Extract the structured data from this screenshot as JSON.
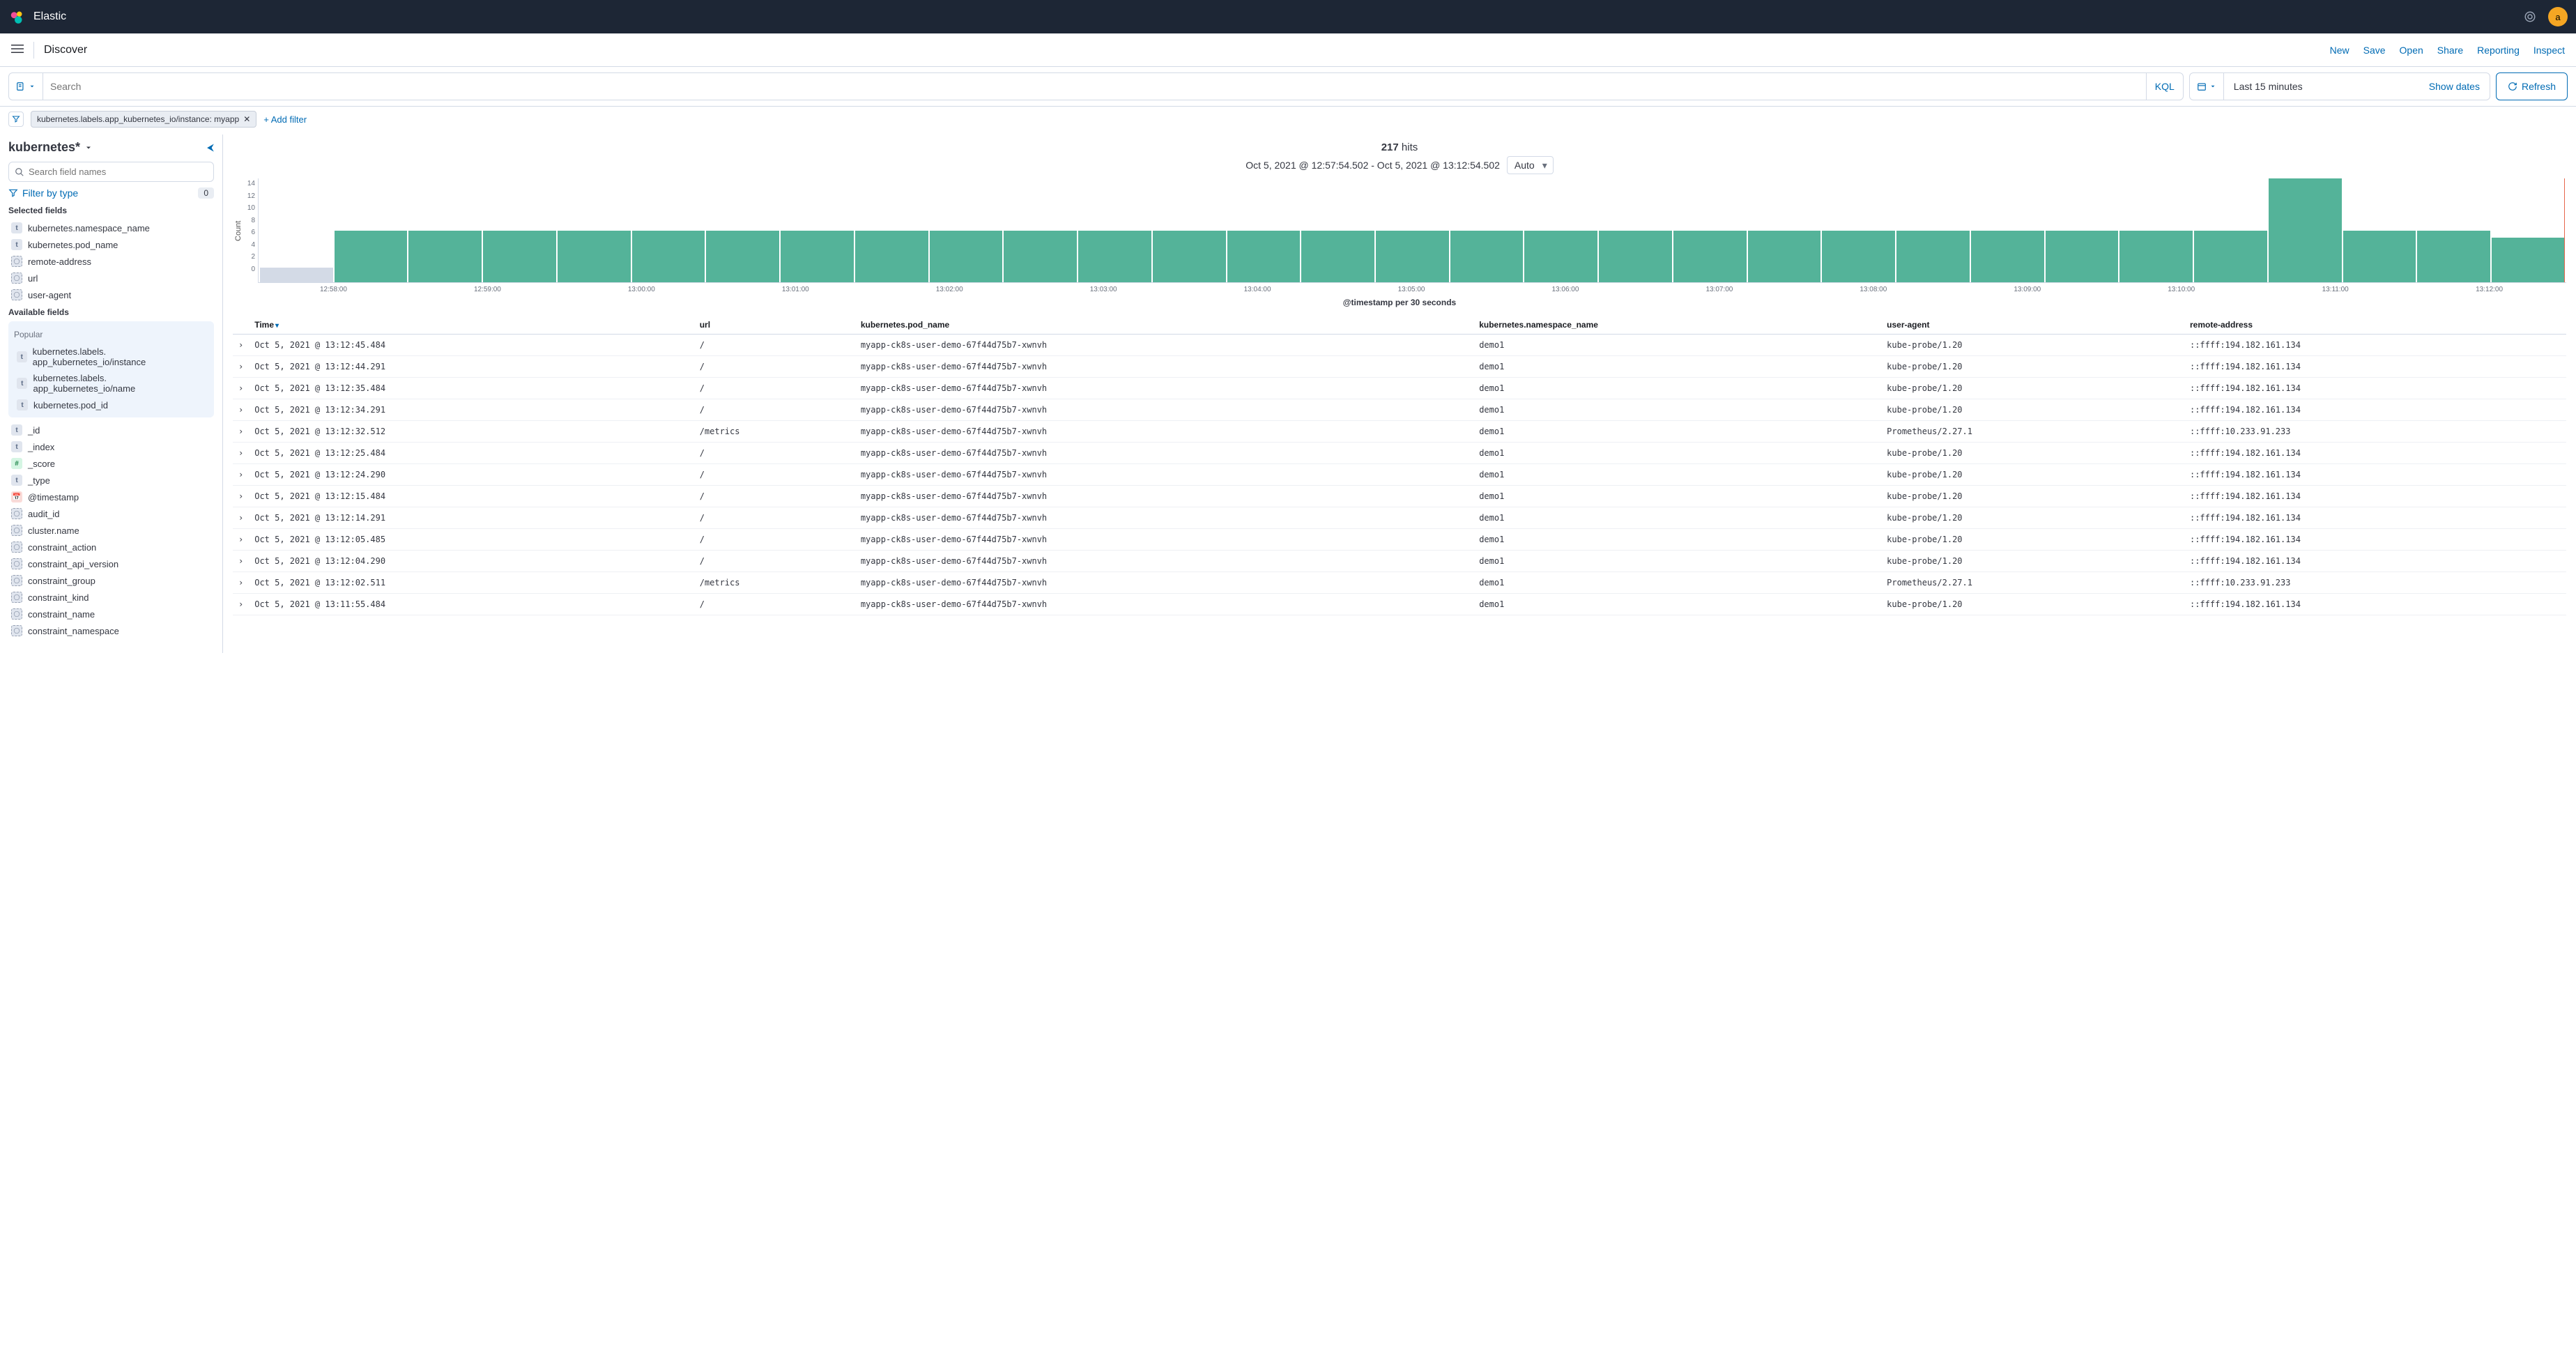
{
  "header": {
    "brand": "Elastic",
    "avatar_letter": "a"
  },
  "subbar": {
    "app_title": "Discover",
    "links": [
      "New",
      "Save",
      "Open",
      "Share",
      "Reporting",
      "Inspect"
    ]
  },
  "search": {
    "placeholder": "Search",
    "lang": "KQL",
    "quick_range": "Last 15 minutes",
    "show_dates": "Show dates",
    "refresh": "Refresh"
  },
  "filterrow": {
    "pill": "kubernetes.labels.app_kubernetes_io/instance: myapp",
    "add_filter": "+ Add filter"
  },
  "sidebar": {
    "index_pattern": "kubernetes*",
    "field_search_placeholder": "Search field names",
    "filter_by_type": "Filter by type",
    "filter_type_count": "0",
    "selected_fields_label": "Selected fields",
    "selected_fields": [
      {
        "type": "t",
        "name": "kubernetes.namespace_name"
      },
      {
        "type": "t",
        "name": "kubernetes.pod_name"
      },
      {
        "type": "n",
        "name": "remote-address"
      },
      {
        "type": "n",
        "name": "url"
      },
      {
        "type": "n",
        "name": "user-agent"
      }
    ],
    "available_fields_label": "Available fields",
    "popular_label": "Popular",
    "popular_fields": [
      {
        "type": "t",
        "name": "kubernetes.labels. app_kubernetes_io/instance"
      },
      {
        "type": "t",
        "name": "kubernetes.labels. app_kubernetes_io/name"
      },
      {
        "type": "t",
        "name": "kubernetes.pod_id"
      }
    ],
    "other_fields": [
      {
        "type": "t",
        "name": "_id"
      },
      {
        "type": "t",
        "name": "_index"
      },
      {
        "type": "nm",
        "name": "_score"
      },
      {
        "type": "t",
        "name": "_type"
      },
      {
        "type": "dt",
        "name": "@timestamp"
      },
      {
        "type": "n",
        "name": "audit_id"
      },
      {
        "type": "n",
        "name": "cluster.name"
      },
      {
        "type": "n",
        "name": "constraint_action"
      },
      {
        "type": "n",
        "name": "constraint_api_version"
      },
      {
        "type": "n",
        "name": "constraint_group"
      },
      {
        "type": "n",
        "name": "constraint_kind"
      },
      {
        "type": "n",
        "name": "constraint_name"
      },
      {
        "type": "n",
        "name": "constraint_namespace"
      }
    ]
  },
  "hits": {
    "count": "217",
    "suffix": "hits"
  },
  "chart_data": {
    "type": "bar",
    "range_text": "Oct 5, 2021 @ 12:57:54.502 - Oct 5, 2021 @ 13:12:54.502",
    "interval_select": "Auto",
    "ylabel": "Count",
    "xlabel": "@timestamp per 30 seconds",
    "ylim": [
      0,
      14
    ],
    "y_ticks": [
      "14",
      "12",
      "10",
      "8",
      "6",
      "4",
      "2",
      "0"
    ],
    "x_ticks": [
      "12:58:00",
      "12:59:00",
      "13:00:00",
      "13:01:00",
      "13:02:00",
      "13:03:00",
      "13:04:00",
      "13:05:00",
      "13:06:00",
      "13:07:00",
      "13:08:00",
      "13:09:00",
      "13:10:00",
      "13:11:00",
      "13:12:00"
    ],
    "values": [
      2,
      7,
      7,
      7,
      7,
      7,
      7,
      7,
      7,
      7,
      7,
      7,
      7,
      7,
      7,
      7,
      7,
      7,
      7,
      7,
      7,
      7,
      7,
      7,
      7,
      7,
      7,
      14,
      7,
      7,
      6
    ],
    "dim_first": true
  },
  "table": {
    "columns": [
      "Time",
      "url",
      "kubernetes.pod_name",
      "kubernetes.namespace_name",
      "user-agent",
      "remote-address"
    ],
    "sort_col": 0,
    "rows": [
      [
        "Oct 5, 2021 @ 13:12:45.484",
        "/",
        "myapp-ck8s-user-demo-67f44d75b7-xwnvh",
        "demo1",
        "kube-probe/1.20",
        "::ffff:194.182.161.134"
      ],
      [
        "Oct 5, 2021 @ 13:12:44.291",
        "/",
        "myapp-ck8s-user-demo-67f44d75b7-xwnvh",
        "demo1",
        "kube-probe/1.20",
        "::ffff:194.182.161.134"
      ],
      [
        "Oct 5, 2021 @ 13:12:35.484",
        "/",
        "myapp-ck8s-user-demo-67f44d75b7-xwnvh",
        "demo1",
        "kube-probe/1.20",
        "::ffff:194.182.161.134"
      ],
      [
        "Oct 5, 2021 @ 13:12:34.291",
        "/",
        "myapp-ck8s-user-demo-67f44d75b7-xwnvh",
        "demo1",
        "kube-probe/1.20",
        "::ffff:194.182.161.134"
      ],
      [
        "Oct 5, 2021 @ 13:12:32.512",
        "/metrics",
        "myapp-ck8s-user-demo-67f44d75b7-xwnvh",
        "demo1",
        "Prometheus/2.27.1",
        "::ffff:10.233.91.233"
      ],
      [
        "Oct 5, 2021 @ 13:12:25.484",
        "/",
        "myapp-ck8s-user-demo-67f44d75b7-xwnvh",
        "demo1",
        "kube-probe/1.20",
        "::ffff:194.182.161.134"
      ],
      [
        "Oct 5, 2021 @ 13:12:24.290",
        "/",
        "myapp-ck8s-user-demo-67f44d75b7-xwnvh",
        "demo1",
        "kube-probe/1.20",
        "::ffff:194.182.161.134"
      ],
      [
        "Oct 5, 2021 @ 13:12:15.484",
        "/",
        "myapp-ck8s-user-demo-67f44d75b7-xwnvh",
        "demo1",
        "kube-probe/1.20",
        "::ffff:194.182.161.134"
      ],
      [
        "Oct 5, 2021 @ 13:12:14.291",
        "/",
        "myapp-ck8s-user-demo-67f44d75b7-xwnvh",
        "demo1",
        "kube-probe/1.20",
        "::ffff:194.182.161.134"
      ],
      [
        "Oct 5, 2021 @ 13:12:05.485",
        "/",
        "myapp-ck8s-user-demo-67f44d75b7-xwnvh",
        "demo1",
        "kube-probe/1.20",
        "::ffff:194.182.161.134"
      ],
      [
        "Oct 5, 2021 @ 13:12:04.290",
        "/",
        "myapp-ck8s-user-demo-67f44d75b7-xwnvh",
        "demo1",
        "kube-probe/1.20",
        "::ffff:194.182.161.134"
      ],
      [
        "Oct 5, 2021 @ 13:12:02.511",
        "/metrics",
        "myapp-ck8s-user-demo-67f44d75b7-xwnvh",
        "demo1",
        "Prometheus/2.27.1",
        "::ffff:10.233.91.233"
      ],
      [
        "Oct 5, 2021 @ 13:11:55.484",
        "/",
        "myapp-ck8s-user-demo-67f44d75b7-xwnvh",
        "demo1",
        "kube-probe/1.20",
        "::ffff:194.182.161.134"
      ]
    ]
  }
}
